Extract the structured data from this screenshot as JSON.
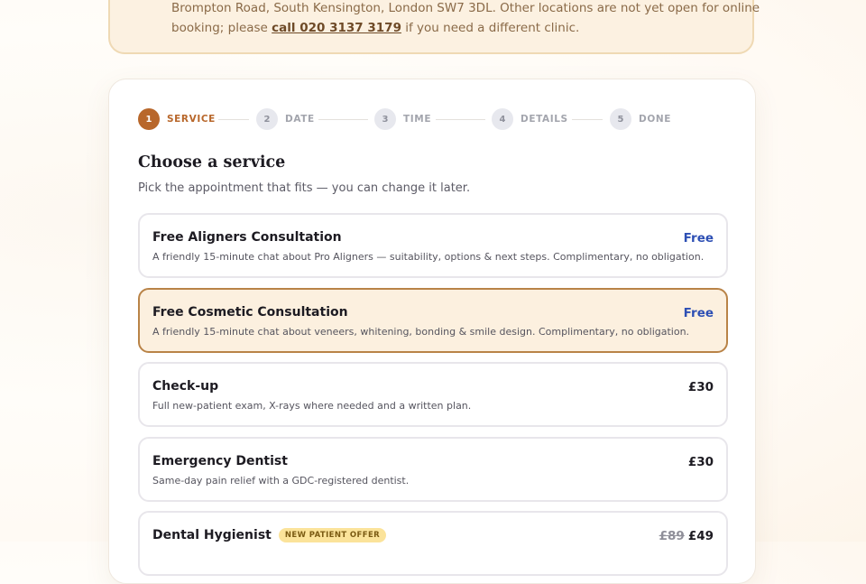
{
  "notice": {
    "line1": "Brompton Road, South Kensington, London SW7 3DL. Other locations are not yet open for online",
    "line2_before": "booking; please",
    "phone_link": "call 020 3137 3179",
    "line2_after": "if you need a different clinic."
  },
  "stepper": {
    "steps": [
      {
        "number": "1",
        "label": "SERVICE",
        "state": "active"
      },
      {
        "number": "2",
        "label": "DATE",
        "state": "pending"
      },
      {
        "number": "3",
        "label": "TIME",
        "state": "pending"
      },
      {
        "number": "4",
        "label": "DETAILS",
        "state": "pending"
      },
      {
        "number": "5",
        "label": "DONE",
        "state": "pending"
      }
    ]
  },
  "main": {
    "heading": "Choose a service",
    "subheading": "Pick the appointment that fits — you can change it later."
  },
  "services": [
    {
      "title": "Free Aligners Consultation",
      "description": "A friendly 15-minute chat about Pro Aligners — suitability, options & next steps. Complimentary, no obligation.",
      "price": "Free",
      "selected": false
    },
    {
      "title": "Free Cosmetic Consultation",
      "description": "A friendly 15-minute chat about veneers, whitening, bonding & smile design. Complimentary, no obligation.",
      "price": "Free",
      "selected": true
    },
    {
      "title": "Check-up",
      "description": "Full new-patient exam, X-rays where needed and a written plan.",
      "price": "£30",
      "selected": false
    },
    {
      "title": "Emergency Dentist",
      "description": "Same-day pain relief with a GDC-registered dentist.",
      "price": "£30",
      "selected": false
    },
    {
      "title": "Dental Hygienist",
      "badge": "NEW PATIENT OFFER",
      "old_price": "£89",
      "price": "£49",
      "selected": false
    }
  ],
  "colors": {
    "accent": "#b8672b",
    "selected_border": "#b98347",
    "selected_background": "#fcf0df",
    "free_price": "#2d4fb4",
    "badge_background": "#fbe39a"
  }
}
